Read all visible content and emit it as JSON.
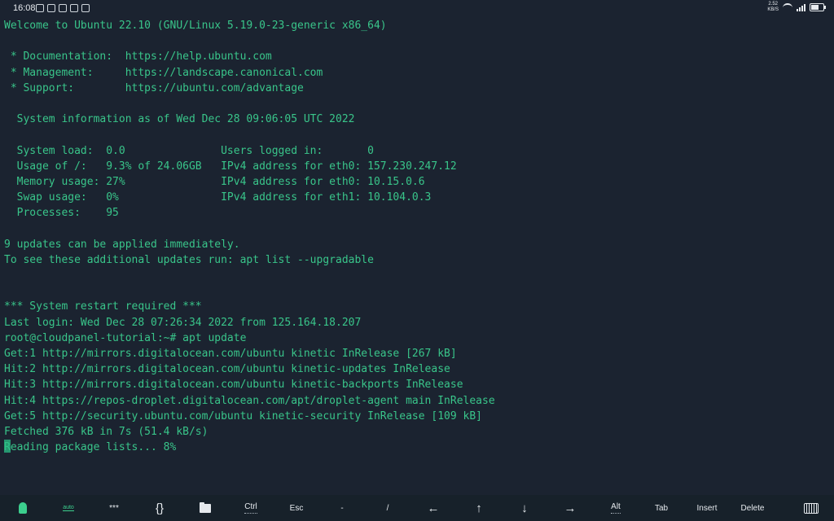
{
  "status_bar": {
    "time": "16:08",
    "net_speed_value": "2.52",
    "net_speed_unit": "KB/S",
    "battery_level": 0.7
  },
  "terminal": {
    "lines": [
      "Welcome to Ubuntu 22.10 (GNU/Linux 5.19.0-23-generic x86_64)",
      "",
      " * Documentation:  https://help.ubuntu.com",
      " * Management:     https://landscape.canonical.com",
      " * Support:        https://ubuntu.com/advantage",
      "",
      "  System information as of Wed Dec 28 09:06:05 UTC 2022",
      "",
      "  System load:  0.0               Users logged in:       0",
      "  Usage of /:   9.3% of 24.06GB   IPv4 address for eth0: 157.230.247.12",
      "  Memory usage: 27%               IPv4 address for eth0: 10.15.0.6",
      "  Swap usage:   0%                IPv4 address for eth1: 10.104.0.3",
      "  Processes:    95",
      "",
      "9 updates can be applied immediately.",
      "To see these additional updates run: apt list --upgradable",
      "",
      "",
      "*** System restart required ***",
      "Last login: Wed Dec 28 07:26:34 2022 from 125.164.18.207",
      "root@cloudpanel-tutorial:~# apt update",
      "Get:1 http://mirrors.digitalocean.com/ubuntu kinetic InRelease [267 kB]",
      "Hit:2 http://mirrors.digitalocean.com/ubuntu kinetic-updates InRelease",
      "Hit:3 http://mirrors.digitalocean.com/ubuntu kinetic-backports InRelease",
      "Hit:4 https://repos-droplet.digitalocean.com/apt/droplet-agent main InRelease",
      "Get:5 http://security.ubuntu.com/ubuntu kinetic-security InRelease [109 kB]",
      "Fetched 376 kB in 7s (51.4 kB/s)"
    ],
    "current_line": "Reading package lists... 8%"
  },
  "extra_keys": {
    "auto": "auto",
    "password": "***",
    "braces": "{}",
    "ctrl": "Ctrl",
    "esc": "Esc",
    "dash": "-",
    "slash": "/",
    "left": "←",
    "up": "↑",
    "down": "↓",
    "right": "→",
    "alt": "Alt",
    "tab": "Tab",
    "insert": "Insert",
    "delete": "Delete"
  }
}
